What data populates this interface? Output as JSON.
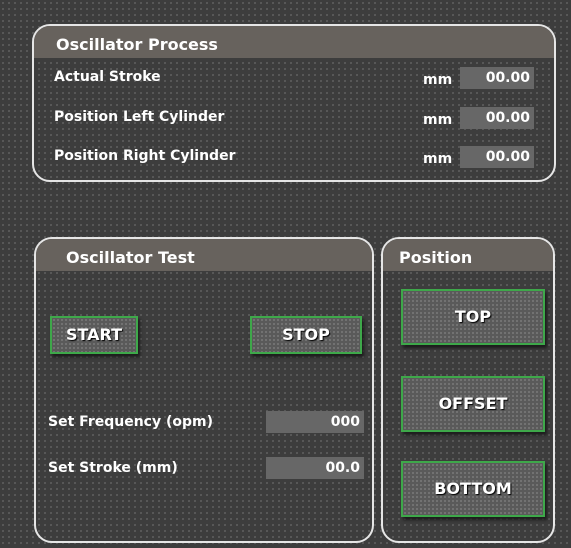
{
  "process": {
    "title": "Oscillator Process",
    "rows": [
      {
        "label": "Actual Stroke",
        "unit": "mm",
        "value": "00.00"
      },
      {
        "label": "Position Left Cylinder",
        "unit": "mm",
        "value": "00.00"
      },
      {
        "label": "Position Right Cylinder",
        "unit": "mm",
        "value": "00.00"
      }
    ]
  },
  "test": {
    "title": "Oscillator Test",
    "start_label": "START",
    "stop_label": "STOP",
    "frequency_label": "Set Frequency (opm)",
    "frequency_value": "000",
    "stroke_label": "Set Stroke (mm)",
    "stroke_value": "00.0"
  },
  "position": {
    "title": "Position",
    "top_label": "TOP",
    "offset_label": "OFFSET",
    "bottom_label": "BOTTOM"
  },
  "colors": {
    "background": "#3d3d3d",
    "panel_header": "#67625d",
    "panel_border": "#e6e6e6",
    "value_field": "#676767",
    "button_border": "#3ea84a"
  }
}
